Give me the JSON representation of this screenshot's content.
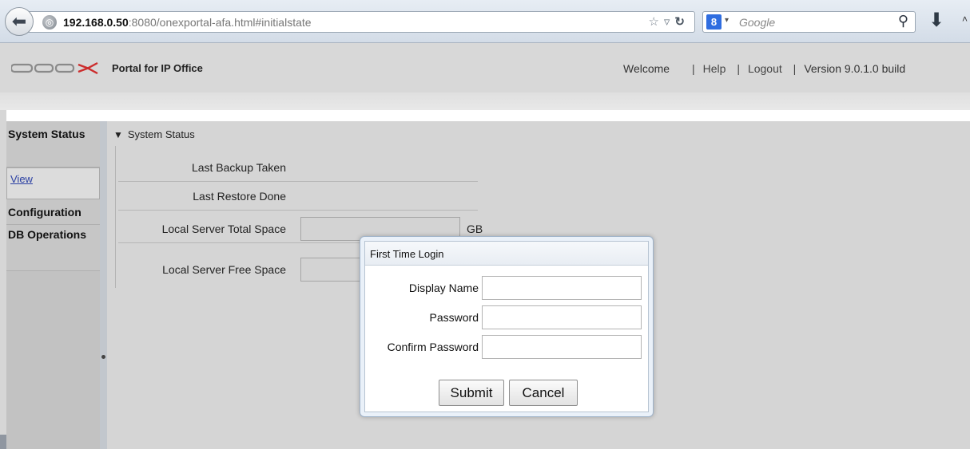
{
  "browser": {
    "url_host": "192.168.0.50",
    "url_rest": ":8080/onexportal-afa.html#initialstate",
    "search_badge": "8",
    "search_placeholder": "Google"
  },
  "header": {
    "logo_text": "one-X",
    "portal_title": "Portal for IP Office",
    "welcome": "Welcome",
    "help": "Help",
    "logout": "Logout",
    "version": "Version 9.0.1.0 build",
    "separator": "|"
  },
  "sidebar": {
    "system_status": "System Status",
    "view_link": "View",
    "configuration": "Configuration",
    "db_operations": "DB Operations"
  },
  "main": {
    "section_title": "System Status",
    "rows": [
      {
        "label": "Last Backup Taken"
      },
      {
        "label": "Last Restore Done"
      },
      {
        "label": "Local Server Total Space",
        "unit": "GB"
      },
      {
        "label": "Local Server Free Space"
      }
    ]
  },
  "dialog": {
    "title": "First Time Login",
    "display_name_label": "Display Name",
    "password_label": "Password",
    "confirm_password_label": "Confirm Password",
    "display_name_value": "",
    "password_value": "",
    "confirm_password_value": "",
    "submit_label": "Submit",
    "cancel_label": "Cancel"
  }
}
